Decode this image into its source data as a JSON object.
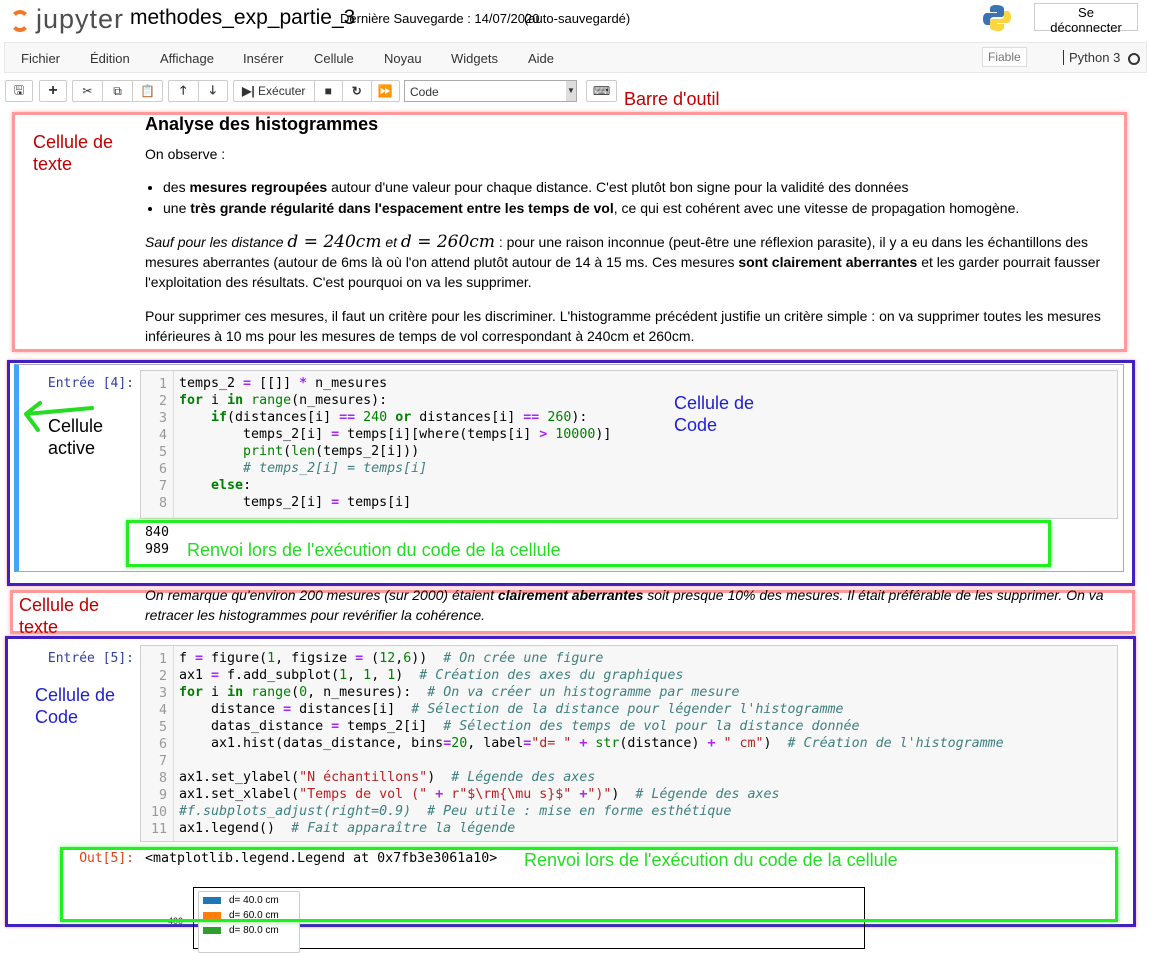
{
  "header": {
    "logo_text": "jupyter",
    "notebook_name": "methodes_exp_partie_3",
    "save_status": "Dernière Sauvegarde : 14/07/2020",
    "autosave": "(auto-sauvegardé)",
    "logout": "Se déconnecter"
  },
  "menu": {
    "items": [
      "Fichier",
      "Édition",
      "Affichage",
      "Insérer",
      "Cellule",
      "Noyau",
      "Widgets",
      "Aide"
    ],
    "trusted": "Fiable",
    "kernel": "Python 3"
  },
  "toolbar": {
    "run_label": "Exécuter",
    "cell_type": "Code"
  },
  "annotations": {
    "toolbar": "Barre d'outil",
    "text_cell_1": "Cellule de\ntexte",
    "code_cell_1": "Cellule de\nCode",
    "active": "Cellule\nactive",
    "output_1": "Renvoi lors de l'exécution du code de la cellule",
    "text_cell_2": "Cellule de\ntexte",
    "code_cell_2": "Cellule de\nCode",
    "output_2": "Renvoi lors de l'exécution du code de la cellule"
  },
  "cell1": {
    "heading": "Analyse des histogrammes",
    "intro": "On observe :",
    "b1": [
      "des ",
      "mesures regroupées",
      " autour d'une valeur pour chaque distance. C'est plutôt bon signe pour la validité des données"
    ],
    "b2": [
      "une ",
      "très grande régularité dans l'espacement entre les temps de vol",
      ", ce qui est cohérent avec une vitesse de propagation homogène."
    ],
    "p2": [
      "Sauf pour les distance ",
      "d = 240cm",
      " et ",
      "d = 260cm",
      " : pour une raison inconnue (peut-être une réflexion parasite), il y a eu dans les échantillons des mesures aberrantes (autour de 6ms là où l'on attend plutôt autour de 14 à 15 ms. Ces mesures ",
      "sont clairement aberrantes",
      " et les garder pourrait fausser l'exploitation des résultats. C'est pourquoi on va les supprimer."
    ],
    "p3": "Pour supprimer ces mesures, il faut un critère pour les discriminer. L'histogramme précédent justifie un critère simple : on va supprimer toutes les mesures inférieures à 10 ms pour les mesures de temps de vol correspondant à 240cm et 260cm."
  },
  "cell2": {
    "prompt": "Entrée [4]:",
    "code": [
      [
        [
          "",
          "temps_2 "
        ],
        [
          "op",
          "="
        ],
        [
          "",
          " [[]] "
        ],
        [
          "op",
          "*"
        ],
        [
          "",
          " n_mesures"
        ]
      ],
      [
        [
          "kw",
          "for"
        ],
        [
          "",
          " i "
        ],
        [
          "kw",
          "in"
        ],
        [
          "",
          " "
        ],
        [
          "bi",
          "range"
        ],
        [
          "",
          "(n_mesures):"
        ]
      ],
      [
        [
          "",
          "    "
        ],
        [
          "kw",
          "if"
        ],
        [
          "",
          "(distances[i] "
        ],
        [
          "op",
          "=="
        ],
        [
          "",
          " "
        ],
        [
          "num",
          "240"
        ],
        [
          "",
          " "
        ],
        [
          "kw",
          "or"
        ],
        [
          "",
          " distances[i] "
        ],
        [
          "op",
          "=="
        ],
        [
          "",
          " "
        ],
        [
          "num",
          "260"
        ],
        [
          "",
          "):"
        ]
      ],
      [
        [
          "",
          "        temps_2[i] "
        ],
        [
          "op",
          "="
        ],
        [
          "",
          " temps[i][where(temps[i] "
        ],
        [
          "op",
          ">"
        ],
        [
          "",
          " "
        ],
        [
          "num",
          "10000"
        ],
        [
          "",
          ")]"
        ]
      ],
      [
        [
          "",
          "        "
        ],
        [
          "bi",
          "print"
        ],
        [
          "",
          "("
        ],
        [
          "bi",
          "len"
        ],
        [
          "",
          "(temps_2[i]))"
        ]
      ],
      [
        [
          "",
          "        "
        ],
        [
          "cm",
          "# temps_2[i] = temps[i]"
        ]
      ],
      [
        [
          "",
          "    "
        ],
        [
          "kw",
          "else"
        ],
        [
          "",
          ":"
        ]
      ],
      [
        [
          "",
          "        temps_2[i] "
        ],
        [
          "op",
          "="
        ],
        [
          "",
          " temps[i]"
        ]
      ]
    ],
    "output": [
      "840",
      "989"
    ]
  },
  "cell3": {
    "text": [
      "On remarque qu'environ 200 mesures (sur 2000) étaient ",
      "clairement aberrantes",
      " soit presque 10% des mesures. Il était préférable de les supprimer. On va retracer les histogrammes pour revérifier la cohérence."
    ]
  },
  "cell4": {
    "prompt": "Entrée [5]:",
    "out_prompt": "Out[5]:",
    "code": [
      [
        [
          "",
          "f "
        ],
        [
          "op",
          "="
        ],
        [
          "",
          " figure("
        ],
        [
          "num",
          "1"
        ],
        [
          "",
          ", figsize "
        ],
        [
          "op",
          "="
        ],
        [
          "",
          " ("
        ],
        [
          "num",
          "12"
        ],
        [
          "",
          ","
        ],
        [
          "num",
          "6"
        ],
        [
          "",
          "))  "
        ],
        [
          "cm",
          "# On crée une figure"
        ]
      ],
      [
        [
          "",
          "ax1 "
        ],
        [
          "op",
          "="
        ],
        [
          "",
          " f.add_subplot("
        ],
        [
          "num",
          "1"
        ],
        [
          "",
          ", "
        ],
        [
          "num",
          "1"
        ],
        [
          "",
          ", "
        ],
        [
          "num",
          "1"
        ],
        [
          "",
          ")  "
        ],
        [
          "cm",
          "# Création des axes du graphiques"
        ]
      ],
      [
        [
          "kw",
          "for"
        ],
        [
          "",
          " i "
        ],
        [
          "kw",
          "in"
        ],
        [
          "",
          " "
        ],
        [
          "bi",
          "range"
        ],
        [
          "",
          "("
        ],
        [
          "num",
          "0"
        ],
        [
          "",
          ", n_mesures):  "
        ],
        [
          "cm",
          "# On va créer un histogramme par mesure"
        ]
      ],
      [
        [
          "",
          "    distance "
        ],
        [
          "op",
          "="
        ],
        [
          "",
          " distances[i]  "
        ],
        [
          "cm",
          "# Sélection de la distance pour légender l'histogramme"
        ]
      ],
      [
        [
          "",
          "    datas_distance "
        ],
        [
          "op",
          "="
        ],
        [
          "",
          " temps_2[i]  "
        ],
        [
          "cm",
          "# Sélection des temps de vol pour la distance donnée"
        ]
      ],
      [
        [
          "",
          "    ax1.hist(datas_distance, bins"
        ],
        [
          "op",
          "="
        ],
        [
          "num",
          "20"
        ],
        [
          "",
          ", label"
        ],
        [
          "op",
          "="
        ],
        [
          "str",
          "\"d= \""
        ],
        [
          "",
          " "
        ],
        [
          "op",
          "+"
        ],
        [
          "",
          " "
        ],
        [
          "bi",
          "str"
        ],
        [
          "",
          "(distance) "
        ],
        [
          "op",
          "+"
        ],
        [
          "",
          " "
        ],
        [
          "str",
          "\" cm\""
        ],
        [
          "",
          ")  "
        ],
        [
          "cm",
          "# Création de l'histogramme"
        ]
      ],
      [
        [
          "",
          ""
        ]
      ],
      [
        [
          "",
          "ax1.set_ylabel("
        ],
        [
          "str",
          "\"N échantillons\""
        ],
        [
          "",
          ")  "
        ],
        [
          "cm",
          "# Légende des axes"
        ]
      ],
      [
        [
          "",
          "ax1.set_xlabel("
        ],
        [
          "str",
          "\"Temps de vol (\""
        ],
        [
          "",
          " "
        ],
        [
          "op",
          "+"
        ],
        [
          "",
          " "
        ],
        [
          "str",
          "r\"$\\rm{\\mu s}$\""
        ],
        [
          "",
          " "
        ],
        [
          "op",
          "+"
        ],
        [
          "str",
          "\")\""
        ],
        [
          "",
          ")  "
        ],
        [
          "cm",
          "# Légende des axes"
        ]
      ],
      [
        [
          "cm",
          "#f.subplots_adjust(right=0.9)  # Peu utile : mise en forme esthétique"
        ]
      ],
      [
        [
          "",
          "ax1.legend()  "
        ],
        [
          "cm",
          "# Fait apparaître la légende"
        ]
      ]
    ],
    "output": "<matplotlib.legend.Legend at 0x7fb3e3061a10>",
    "plot": {
      "ytick": "400",
      "legend": [
        {
          "label": "d= 40.0 cm",
          "color": "#1f77b4"
        },
        {
          "label": "d= 60.0 cm",
          "color": "#ff7f0e"
        },
        {
          "label": "d= 80.0 cm",
          "color": "#2ca02c"
        }
      ]
    }
  }
}
